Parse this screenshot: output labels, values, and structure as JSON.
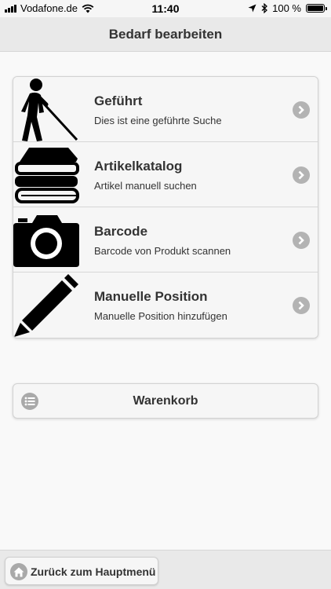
{
  "status_bar": {
    "carrier": "Vodafone.de",
    "time": "11:40",
    "battery": "100 %"
  },
  "header": {
    "title": "Bedarf bearbeiten"
  },
  "menu": {
    "items": [
      {
        "title": "Geführt",
        "subtitle": "Dies ist eine geführte Suche",
        "icon": "blind-person-icon"
      },
      {
        "title": "Artikelkatalog",
        "subtitle": "Artikel manuell suchen",
        "icon": "books-icon"
      },
      {
        "title": "Barcode",
        "subtitle": "Barcode von Produkt scannen",
        "icon": "camera-icon"
      },
      {
        "title": "Manuelle Position",
        "subtitle": "Manuelle Position hinzufügen",
        "icon": "pencil-icon"
      }
    ]
  },
  "cart": {
    "label": "Warenkorb",
    "icon": "list-icon"
  },
  "footer": {
    "back_label": "Zurück zum Hauptmenü",
    "icon": "home-icon"
  }
}
